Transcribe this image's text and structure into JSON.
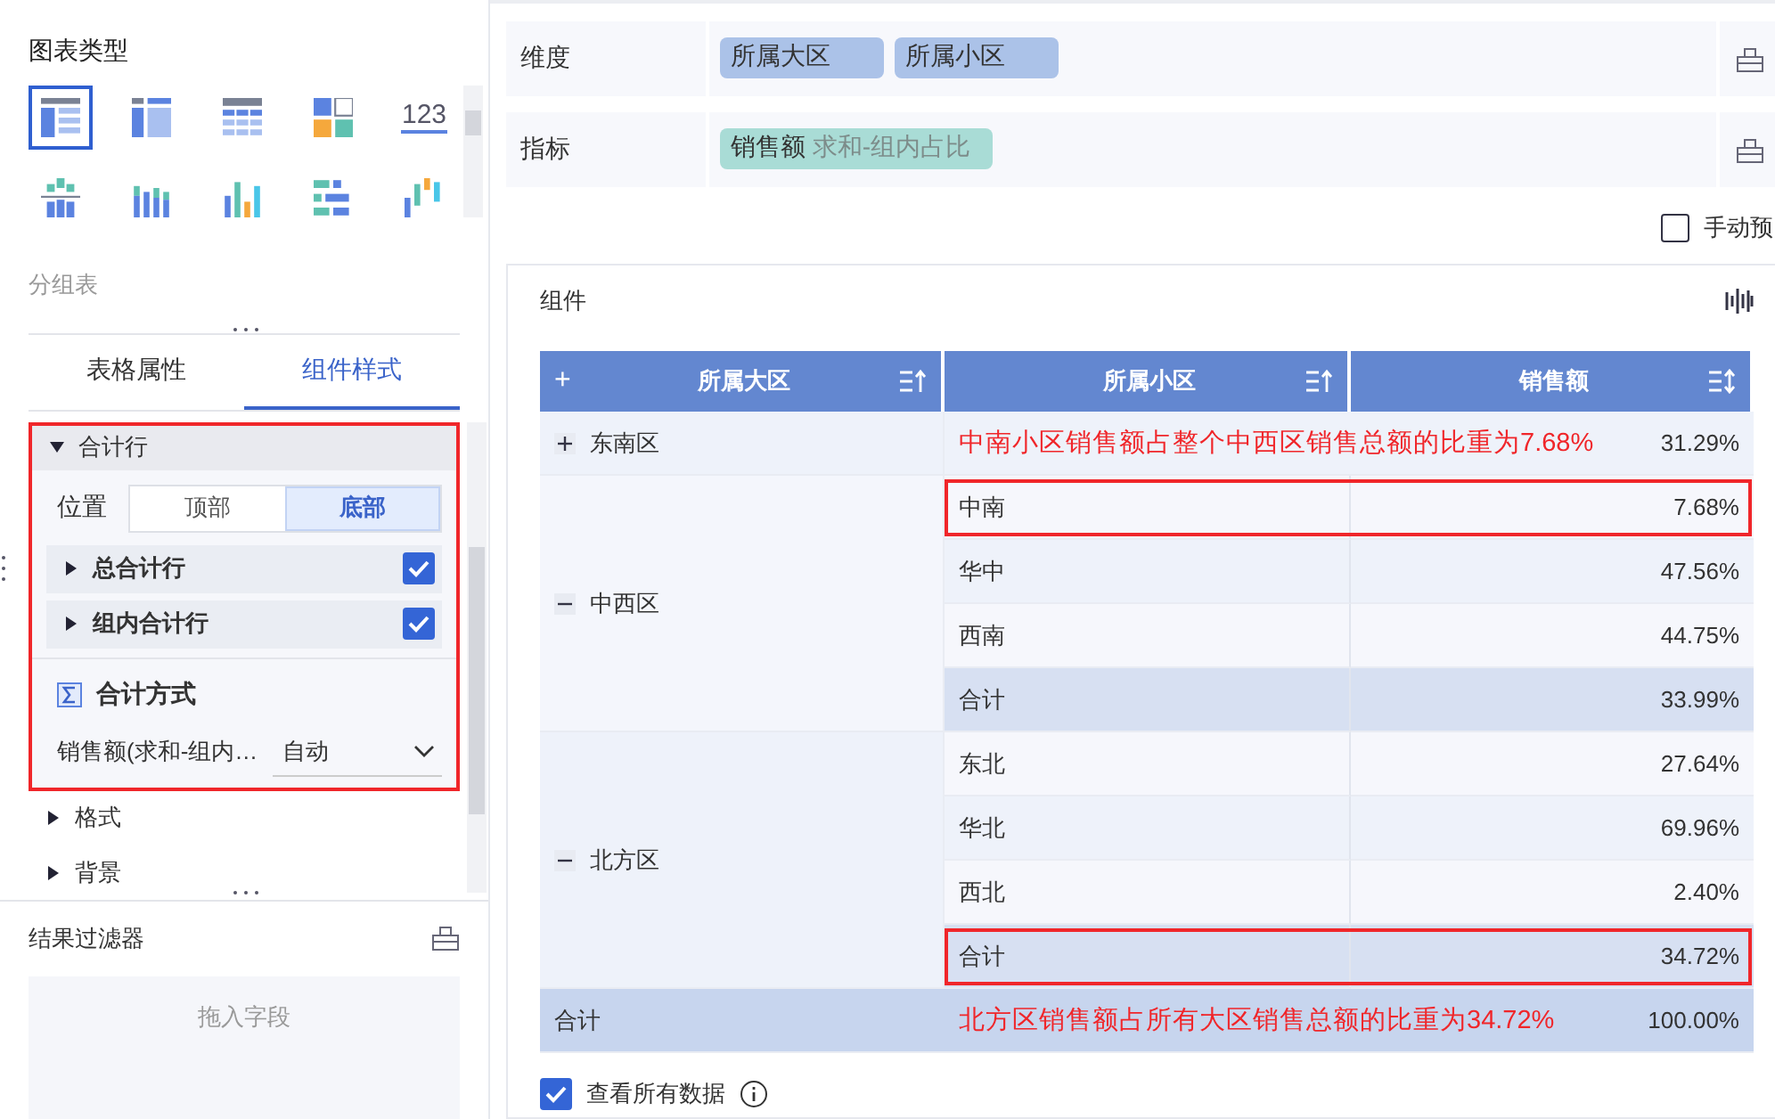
{
  "chart_types": {
    "title": "图表类型",
    "caption": "分组表",
    "items": [
      {
        "kind": "table-grouped",
        "selected": true
      },
      {
        "kind": "table-cross",
        "selected": false
      },
      {
        "kind": "table-detail",
        "selected": false
      },
      {
        "kind": "treemap",
        "selected": false
      },
      {
        "kind": "number",
        "label": "123",
        "selected": false
      },
      {
        "kind": "stacked-split",
        "selected": false
      },
      {
        "kind": "stacked-column",
        "selected": false
      },
      {
        "kind": "column",
        "selected": false
      },
      {
        "kind": "bar-compare",
        "selected": false
      },
      {
        "kind": "waterfall",
        "selected": false
      }
    ]
  },
  "tabs": [
    {
      "label": "表格属性",
      "selected": false
    },
    {
      "label": "组件样式",
      "selected": true
    }
  ],
  "total_row_section": {
    "title": "合计行",
    "expanded": true,
    "highlighted": true,
    "position_label": "位置",
    "positions": [
      {
        "label": "顶部",
        "selected": false
      },
      {
        "label": "底部",
        "selected": true
      }
    ],
    "options": [
      {
        "label": "总合计行",
        "checked": true
      },
      {
        "label": "组内合计行",
        "checked": true
      }
    ],
    "method_title": "合计方式",
    "method_field": "销售额(求和-组内…",
    "method_value": "自动"
  },
  "sections": [
    {
      "label": "格式",
      "expanded": false
    },
    {
      "label": "背景",
      "expanded": false
    }
  ],
  "result_filter": {
    "title": "结果过滤器",
    "placeholder": "拖入字段"
  },
  "dimension": {
    "label": "维度",
    "fields": [
      "所属大区",
      "所属小区"
    ]
  },
  "indicator": {
    "label": "指标",
    "fields": [
      {
        "name": "销售额",
        "detail": "求和-组内占比"
      }
    ]
  },
  "manual_preview": {
    "label": "手动预",
    "checked": false
  },
  "component": {
    "title": "组件"
  },
  "table": {
    "columns": [
      {
        "label": "所属大区",
        "toggle": "+",
        "kind": "sort-asc"
      },
      {
        "label": "所属小区",
        "kind": "sort-asc"
      },
      {
        "label": "销售额",
        "kind": "sort-both"
      }
    ],
    "regions": [
      {
        "name": "东南区",
        "expanded": false,
        "value": "31.29%",
        "annotation": "中南小区销售额占整个中西区销售总额的比重为7.68%"
      },
      {
        "name": "中西区",
        "expanded": true,
        "children": [
          {
            "name": "中南",
            "value": "7.68%",
            "kind": "item",
            "highlighted": true
          },
          {
            "name": "华中",
            "value": "47.56%",
            "kind": "item",
            "highlighted": false
          },
          {
            "name": "西南",
            "value": "44.75%",
            "kind": "item",
            "highlighted": false
          },
          {
            "name": "合计",
            "value": "33.99%",
            "kind": "subtotal",
            "highlighted": false
          }
        ]
      },
      {
        "name": "北方区",
        "expanded": true,
        "children": [
          {
            "name": "东北",
            "value": "27.64%",
            "kind": "item",
            "highlighted": false
          },
          {
            "name": "华北",
            "value": "69.96%",
            "kind": "item",
            "highlighted": false
          },
          {
            "name": "西北",
            "value": "2.40%",
            "kind": "item",
            "highlighted": false
          },
          {
            "name": "合计",
            "value": "34.72%",
            "kind": "subtotal",
            "highlighted": true
          }
        ]
      }
    ],
    "total": {
      "label": "合计",
      "value": "100.00%",
      "annotation": "北方区销售额占所有大区销售总额的比重为34.72%"
    }
  },
  "footer": {
    "label": "查看所有数据",
    "checked": true
  }
}
